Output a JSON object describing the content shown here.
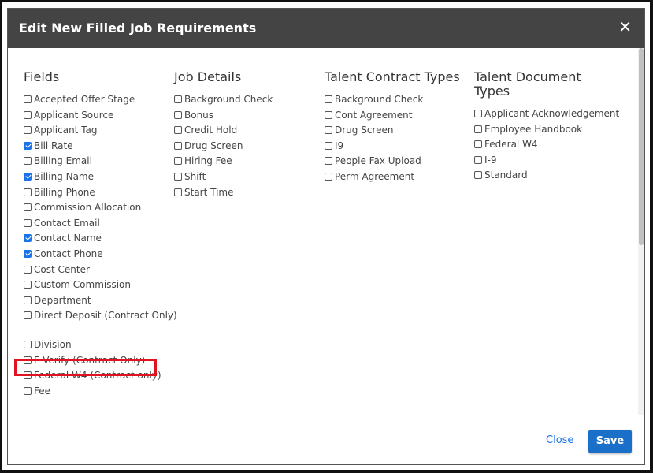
{
  "modal": {
    "title": "Edit New Filled Job Requirements",
    "close_label": "✕"
  },
  "fields": {
    "heading": "Fields",
    "items": [
      {
        "label": "Accepted Offer Stage",
        "checked": false
      },
      {
        "label": "Applicant Source",
        "checked": false
      },
      {
        "label": "Applicant Tag",
        "checked": false
      },
      {
        "label": "Bill Rate",
        "checked": true
      },
      {
        "label": "Billing Email",
        "checked": false
      },
      {
        "label": "Billing Name",
        "checked": true
      },
      {
        "label": "Billing Phone",
        "checked": false
      },
      {
        "label": "Commission Allocation",
        "checked": false
      },
      {
        "label": "Contact Email",
        "checked": false
      },
      {
        "label": "Contact Name",
        "checked": true
      },
      {
        "label": "Contact Phone",
        "checked": true
      },
      {
        "label": "Cost Center",
        "checked": false
      },
      {
        "label": "Custom Commission",
        "checked": false
      },
      {
        "label": "Department",
        "checked": false
      },
      {
        "label": "Direct Deposit (Contract Only)",
        "checked": false
      },
      {
        "label": "Division",
        "checked": false
      },
      {
        "label": "E-Verify (Contract Only)",
        "checked": false
      },
      {
        "label": "Federal W4 (Contract only)",
        "checked": false
      },
      {
        "label": "Fee",
        "checked": false
      }
    ]
  },
  "job_details": {
    "heading": "Job Details",
    "items": [
      {
        "label": "Background Check",
        "checked": false
      },
      {
        "label": "Bonus",
        "checked": false
      },
      {
        "label": "Credit Hold",
        "checked": false
      },
      {
        "label": "Drug Screen",
        "checked": false
      },
      {
        "label": "Hiring Fee",
        "checked": false
      },
      {
        "label": "Shift",
        "checked": false
      },
      {
        "label": "Start Time",
        "checked": false
      }
    ]
  },
  "talent_contract_types": {
    "heading": "Talent Contract Types",
    "items": [
      {
        "label": "Background Check",
        "checked": false
      },
      {
        "label": "Cont Agreement",
        "checked": false
      },
      {
        "label": "Drug Screen",
        "checked": false
      },
      {
        "label": "I9",
        "checked": false
      },
      {
        "label": "People Fax Upload",
        "checked": false
      },
      {
        "label": "Perm Agreement",
        "checked": false
      }
    ]
  },
  "talent_document_types": {
    "heading_line1": "Talent Document",
    "heading_line2": "Types",
    "items": [
      {
        "label": "Applicant Acknowledgement",
        "checked": false
      },
      {
        "label": "Employee Handbook",
        "checked": false
      },
      {
        "label": "Federal W4",
        "checked": false
      },
      {
        "label": "I-9",
        "checked": false
      },
      {
        "label": "Standard",
        "checked": false
      }
    ]
  },
  "footer": {
    "close_label": "Close",
    "save_label": "Save"
  },
  "colors": {
    "header_bg": "#444444",
    "accent": "#1a73e8",
    "highlight": "#e0141e"
  }
}
